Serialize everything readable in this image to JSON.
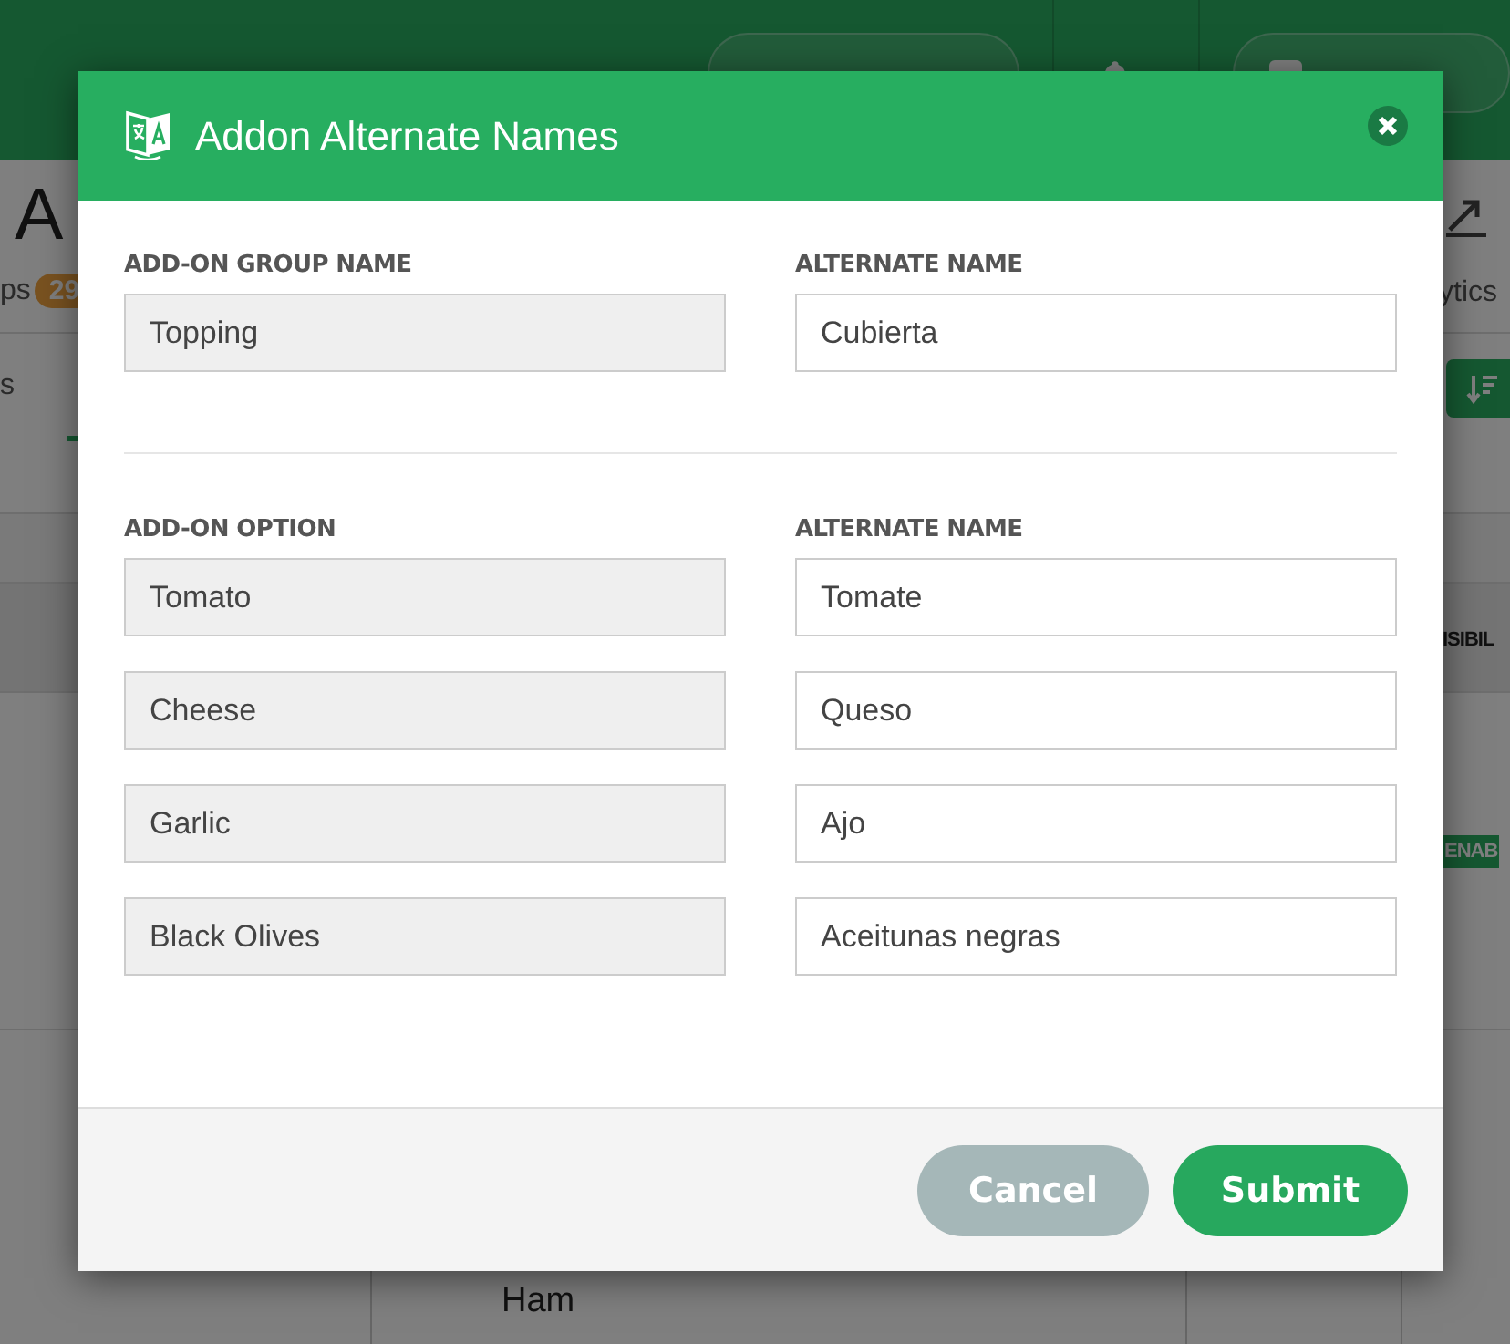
{
  "background": {
    "page_title": "A",
    "count_label": "ps",
    "count_badge": "29",
    "tab": "s",
    "analytics_label": "ytics",
    "column_header": "ISIBIL",
    "status_badge": "ENAB",
    "row_cell": "Ham"
  },
  "dialog": {
    "title": "Addon Alternate Names",
    "group": {
      "name_label": "ADD-ON GROUP NAME",
      "alt_label": "ALTERNATE NAME",
      "name": "Topping",
      "alternate": "Cubierta"
    },
    "options_label": "ADD-ON OPTION",
    "options_alt_label": "ALTERNATE NAME",
    "options": [
      {
        "name": "Tomato",
        "alternate": "Tomate"
      },
      {
        "name": "Cheese",
        "alternate": "Queso"
      },
      {
        "name": "Garlic",
        "alternate": "Ajo"
      },
      {
        "name": "Black Olives",
        "alternate": "Aceitunas negras"
      }
    ],
    "buttons": [
      {
        "label": "Cancel",
        "kind": "secondary"
      },
      {
        "label": "Submit",
        "kind": "primary"
      }
    ]
  }
}
